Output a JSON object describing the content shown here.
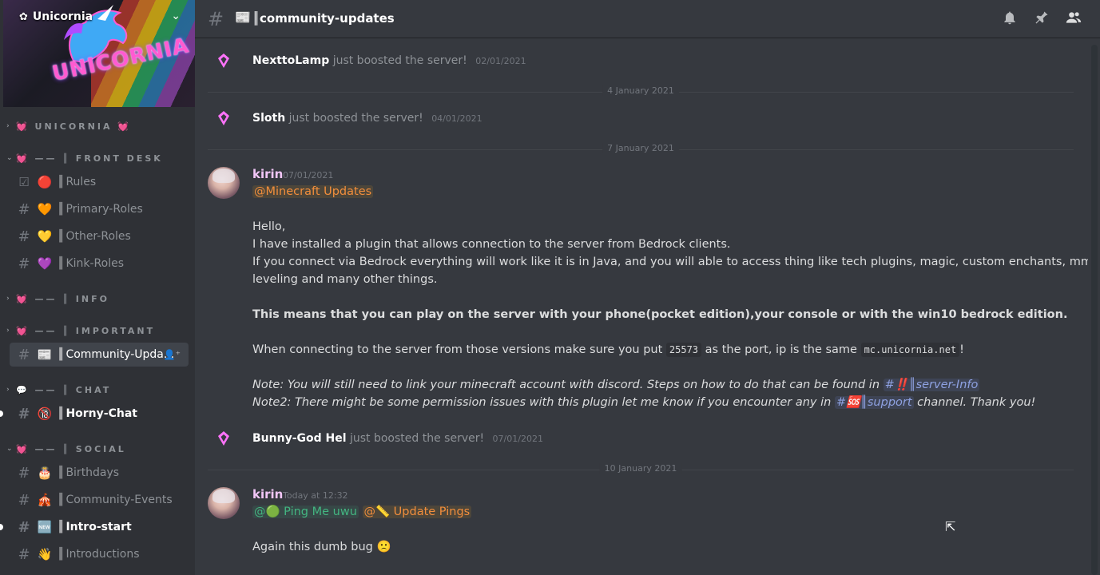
{
  "server": {
    "name": "Unicornia",
    "banner_text": "UNICORNIA"
  },
  "sidebar": {
    "categories": [
      {
        "label": "💓 UNICORNIA 💓"
      },
      {
        "label": "💓 —— ║ FRONT DESK"
      },
      {
        "label": "💓 —— ║ INFO"
      },
      {
        "label": "💓 —— ║ IMPORTANT"
      },
      {
        "label": "💬 —— ║ CHAT"
      },
      {
        "label": "💓 —— ║ SOCIAL"
      }
    ],
    "channels": [
      {
        "emoji": "🔴",
        "name": "Rules",
        "icon": "rules-checkbox-icon"
      },
      {
        "emoji": "🧡",
        "name": "Primary-Roles"
      },
      {
        "emoji": "💛",
        "name": "Other-Roles"
      },
      {
        "emoji": "💜",
        "name": "Kink-Roles"
      },
      {
        "emoji": "📰",
        "name": "Community-Upda..."
      },
      {
        "emoji": "🔞",
        "name": "Horny-Chat"
      },
      {
        "emoji": "🎂",
        "name": "Birthdays"
      },
      {
        "emoji": "🎪",
        "name": "Community-Events"
      },
      {
        "emoji": "🆕",
        "name": "Intro-start"
      },
      {
        "emoji": "👋",
        "name": "Introductions"
      }
    ]
  },
  "header": {
    "emoji": "📰",
    "title": "community-updates",
    "icons": [
      "bell-icon",
      "pin-icon",
      "members-icon"
    ]
  },
  "messages": {
    "boost1": {
      "user": "NexttoLamp",
      "text": "just boosted the server!",
      "date": "02/01/2021"
    },
    "divider1": "4 January 2021",
    "boost2": {
      "user": "Sloth",
      "text": "just boosted the server!",
      "date": "04/01/2021"
    },
    "divider2": "7 January 2021",
    "msg1": {
      "user": "kirin",
      "timestamp": "07/01/2021",
      "mention": "@Minecraft Updates",
      "l1": "Hello,",
      "l2": "I have installed a plugin that allows connection to the server from Bedrock clients.",
      "l3": "If you connect via Bedrock everything will work like it is in Java, and you will able to access thing like tech plugins, magic, custom enchants, mmo",
      "l4": "leveling and many other things.",
      "l5": "This means that you can play on the server with your phone(pocket edition),your console or with the win10 bedrock edition.",
      "l6a": "When connecting to the server from those versions make sure you put",
      "port": "25573",
      "l6b": "as the port, ip is the same",
      "ip": "mc.unicornia.net",
      "l6c": "!",
      "l7a": "Note: You will still need to link your minecraft account with discord. Steps on how to do that can be found in",
      "l7ch": "#‼️║server-Info",
      "l8a": "Note2: There might be some permission issues with this plugin let me know if you encounter any in",
      "l8ch": "#🆘║support",
      "l8b": "channel. Thank you!"
    },
    "boost3": {
      "user": "Bunny-God Hel",
      "text": "just boosted the server!",
      "date": "07/01/2021"
    },
    "divider3": "10 January 2021",
    "msg2": {
      "user": "kirin",
      "timestamp": "Today at 12:32",
      "mention1": "@🟢 Ping Me uwu",
      "mention2": "@📏 Update Pings",
      "l1": "Again this dumb bug 🙁"
    }
  },
  "colors": {
    "bg": "#36393f",
    "sidebar": "#2f3136",
    "mention_orange": "#f28e3c",
    "mention_green": "#43b581",
    "boost_pink": "#ff73fa"
  }
}
